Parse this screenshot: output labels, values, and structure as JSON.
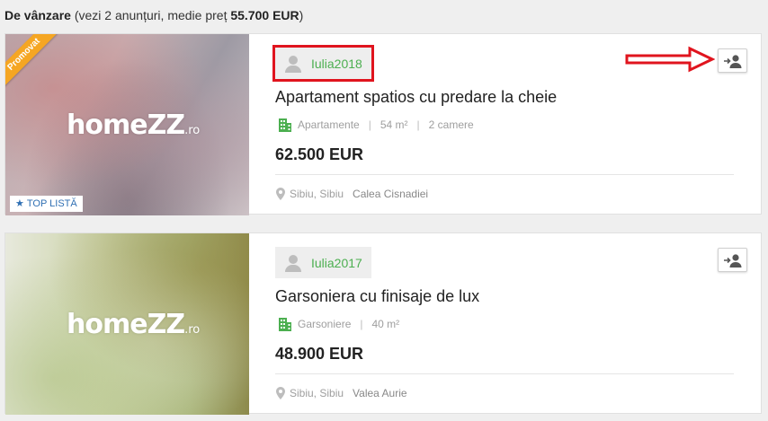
{
  "summary": {
    "label": "De vânzare",
    "detail": "(vezi 2 anunțuri, medie preț ",
    "average_price": "55.700 EUR",
    "close": ")"
  },
  "listings": [
    {
      "badge": "Promovat",
      "top_label": "TOP LISTĂ",
      "logo_text": "homeZZ",
      "logo_tld": ".ro",
      "owner": "Iulia2018",
      "title": "Apartament spatios cu predare la cheie",
      "category": "Apartamente",
      "area": "54 m²",
      "rooms": "2 camere",
      "price": "62.500 EUR",
      "city": "Sibiu, Sibiu",
      "street": "Calea Cisnadiei"
    },
    {
      "logo_text": "homeZZ",
      "logo_tld": ".ro",
      "owner": "Iulia2017",
      "title": "Garsoniera cu finisaje de lux",
      "category": "Garsoniere",
      "area": "40 m²",
      "price": "48.900 EUR",
      "city": "Sibiu, Sibiu",
      "street": "Valea Aurie"
    }
  ],
  "colors": {
    "owner_name": "#4caf50",
    "category_icon": "#4caf50",
    "highlight": "#e0141e",
    "ribbon": "#f5a623"
  },
  "icons": [
    "star-icon",
    "building-icon",
    "location-pin-icon",
    "avatar-icon",
    "contact-owner-icon",
    "annotation-arrow"
  ]
}
